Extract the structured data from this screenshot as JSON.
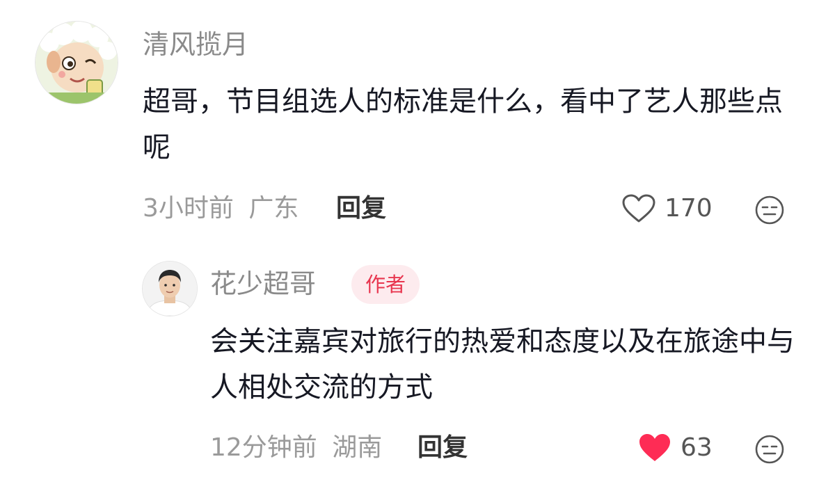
{
  "comment": {
    "username": "清风揽月",
    "avatar": "cartoon-sheep-avatar",
    "text": "超哥，节目组选人的标准是什么，看中了艺人那些点呢",
    "time": "3小时前",
    "location": "广东",
    "reply_label": "回复",
    "like_count": "170",
    "liked": false
  },
  "reply": {
    "username": "花少超哥",
    "badge": "作者",
    "avatar": "man-portrait-avatar",
    "text": "会关注嘉宾对旅行的热爱和态度以及在旅途中与人相处交流的方式",
    "time": "12分钟前",
    "location": "湖南",
    "reply_label": "回复",
    "like_count": "63",
    "liked": true
  },
  "colors": {
    "like_active": "#fe2c55",
    "badge_bg": "#fdebee",
    "badge_text": "#e8364f"
  }
}
